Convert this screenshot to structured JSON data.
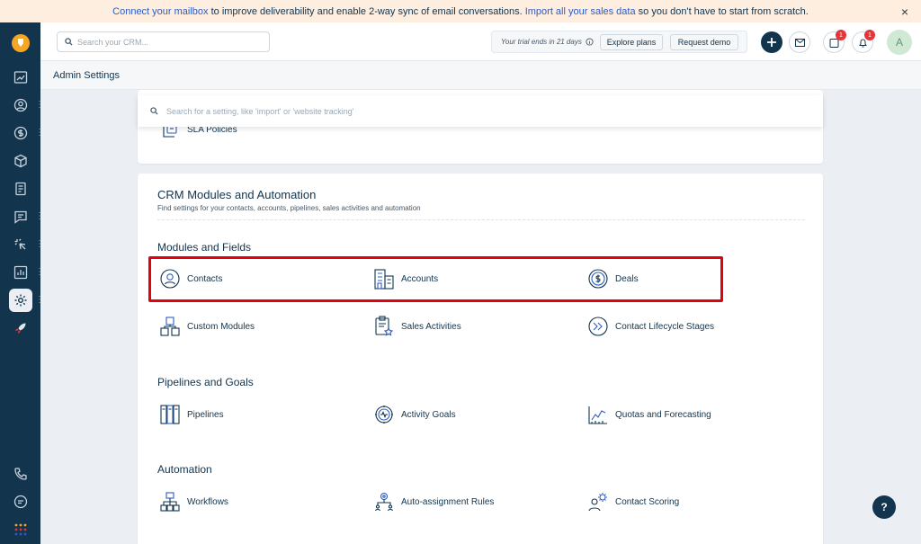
{
  "banner": {
    "link1": "Connect your mailbox",
    "text1": " to improve deliverability and enable 2-way sync of email conversations. ",
    "link2": "Import all your sales data",
    "text2": " so you don't have to start from scratch.",
    "close": "×"
  },
  "topbar": {
    "search_placeholder": "Search your CRM...",
    "trial_text": "Your trial ends in 21 days",
    "explore_label": "Explore plans",
    "request_label": "Request demo",
    "notif_badge": "1",
    "bell_badge": "1",
    "avatar_letter": "A"
  },
  "subbar": {
    "title": "Admin Settings"
  },
  "settings_search_placeholder": "Search for a setting, like 'import' or 'website tracking'",
  "top_card": {
    "sla_label": "SLA Policies"
  },
  "crm_card": {
    "title": "CRM Modules and Automation",
    "subtitle": "Find settings for your contacts, accounts, pipelines, sales activities and automation",
    "modules": {
      "title": "Modules and Fields",
      "items": [
        "Contacts",
        "Accounts",
        "Deals",
        "Custom Modules",
        "Sales Activities",
        "Contact Lifecycle Stages"
      ]
    },
    "pipelines": {
      "title": "Pipelines and Goals",
      "items": [
        "Pipelines",
        "Activity Goals",
        "Quotas and Forecasting"
      ]
    },
    "automation": {
      "title": "Automation",
      "items": [
        "Workflows",
        "Auto-assignment Rules",
        "Contact Scoring"
      ]
    }
  },
  "help_label": "?",
  "colors": {
    "sidebar": "#12344d",
    "highlight": "#e3000f",
    "logo": "#f5a623",
    "link": "#2c5cc5"
  }
}
